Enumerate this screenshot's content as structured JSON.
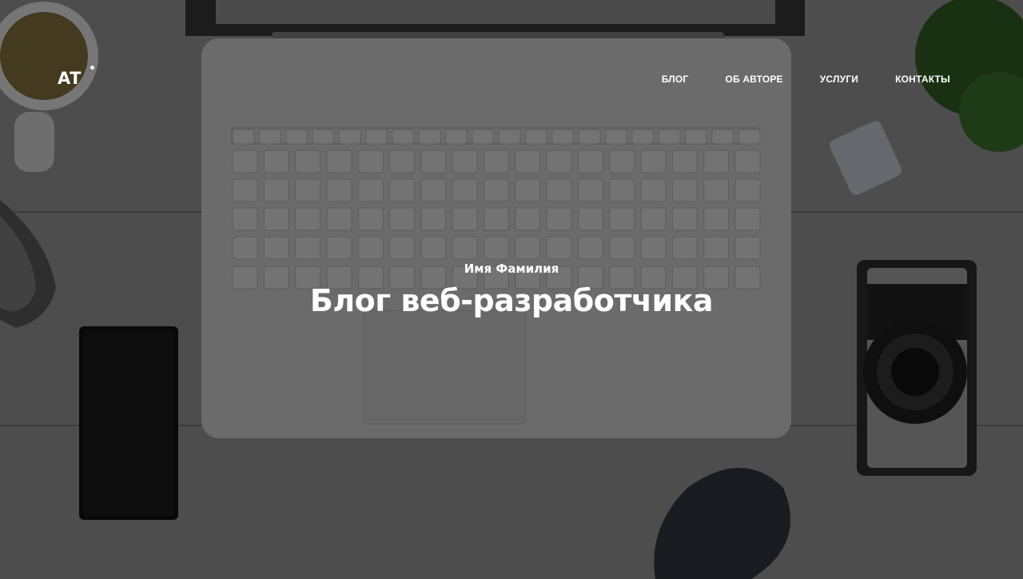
{
  "brand": {
    "logo_text": "AT"
  },
  "nav": {
    "items": [
      {
        "label": "БЛОГ"
      },
      {
        "label": "ОБ АВТОРЕ"
      },
      {
        "label": "УСЛУГИ"
      },
      {
        "label": "КОНТАКТЫ"
      }
    ]
  },
  "intro": {
    "suptitle": "Имя Фамилия",
    "title": "Блог веб-разработчика"
  },
  "colors": {
    "overlay": "#000000",
    "text": "#ffffff",
    "desk": "#8a8a8a"
  }
}
